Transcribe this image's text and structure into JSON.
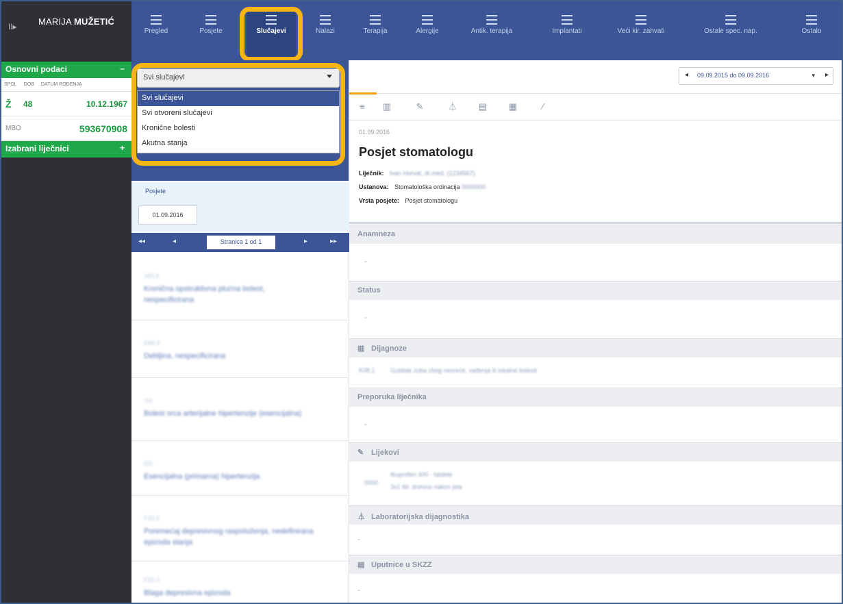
{
  "user": {
    "first_name": "MARIJA",
    "last_name": "MUŽETIĆ",
    "menu_toggle": "II▸"
  },
  "sidebar": {
    "basic_header": "Osnovni podaci",
    "basic_toggle": "–",
    "columns": [
      "SPOL",
      "DOB",
      "DATUM ROĐENJA"
    ],
    "sex": "Ž",
    "age": "48",
    "birth_date": "10.12.1967",
    "mbo_label": "MBO",
    "mbo": "593670908",
    "doctors_header": "Izabrani liječnici",
    "doctors_toggle": "+"
  },
  "topnav": {
    "items": [
      {
        "label": "Pregled"
      },
      {
        "label": "Posjete"
      },
      {
        "label": "Slučajevi"
      },
      {
        "label": "Nalazi"
      },
      {
        "label": "Terapija"
      },
      {
        "label": "Alergije"
      },
      {
        "label": "Antik. terapija"
      },
      {
        "label": "Implantati"
      },
      {
        "label": "Veći kir. zahvati"
      },
      {
        "label": "Ostale spec. nap."
      },
      {
        "label": "Ostalo"
      }
    ],
    "active_index": 2
  },
  "cases_filter": {
    "selected": "Svi slučajevi",
    "options": [
      "Svi slučajevi",
      "Svi otvoreni slučajevi",
      "Kronične bolesti",
      "Akutna stanja"
    ]
  },
  "visits_panel": {
    "label": "Posjete",
    "date_chip": "01.09.2016",
    "pager": {
      "first": "◂◂",
      "prev": "◂",
      "label": "Stranica 1 od 1",
      "next": "▸",
      "last": "▸▸"
    },
    "cases": [
      {
        "code": "J45.9",
        "text": "Kronična opstruktivna plućna bolest, nespecificirana"
      },
      {
        "code": "E66.9",
        "text": "Debljina, nespecificirana"
      },
      {
        "code": "I10",
        "text": "Bolest srca arterijalne hipertenzije (esencijalna)"
      },
      {
        "code": "I20",
        "text": "Esencijalna (primarna) hipertenzija"
      },
      {
        "code": "F32.9",
        "text": "Poremećaj depresivnog raspoloženja, nedefinirana epizoda stanja"
      },
      {
        "code": "F32.0",
        "text": "Blaga depresivna epizoda"
      }
    ]
  },
  "content": {
    "date_range": "09.09.2015 do 09.09.2016",
    "visit_date": "01.09.2016",
    "title": "Posjet stomatologu",
    "doctor_label": "Liječnik:",
    "doctor_value": "Ivan Horvat, dr.med. (1234567)",
    "institution_label": "Ustanova:",
    "institution_value": "Stomatološka ordinacija",
    "institution_code": "0000000",
    "visit_type_label": "Vrsta posjete:",
    "visit_type_value": "Posjet stomatologu",
    "sections": {
      "anamneza": "Anamneza",
      "status": "Status",
      "dijagnoze": "Dijagnoze",
      "preporuka": "Preporuka liječnika",
      "lijekovi": "Lijekovi",
      "laboratorij": "Laboratorijska dijagnostika",
      "uputnice": "Uputnice u SKZZ"
    },
    "dash": "-",
    "diagnosis_code": "K08.1",
    "diagnosis_text": "Gubitak zuba zbog nesreće, vađenja ili lokalne bolesti",
    "drug_code": "0000",
    "drug_name": "Ibuprofen 400 - tablete",
    "drug_detail": "3x1 tbl. dnevno nakon jela"
  }
}
